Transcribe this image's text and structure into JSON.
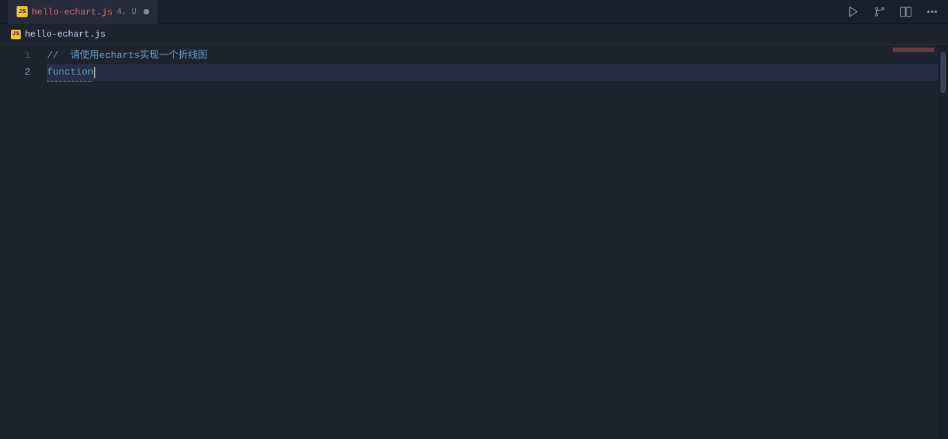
{
  "titleBar": {
    "tab": {
      "filename": "hello-echart.js",
      "badge": "4, U",
      "jsIconLabel": "JS"
    },
    "toolbar": {
      "runLabel": "▷",
      "branchLabel": "⑂",
      "splitLabel": "⧉",
      "moreLabel": "···"
    }
  },
  "breadcrumb": {
    "jsIconLabel": "JS",
    "filename": "hello-echart.js"
  },
  "editor": {
    "lines": [
      {
        "number": "1",
        "content": "//  请使用echarts实现一个折线图",
        "type": "comment",
        "active": false
      },
      {
        "number": "2",
        "content": "function",
        "type": "keyword",
        "active": true,
        "hasError": true,
        "hasCursor": true
      }
    ]
  }
}
